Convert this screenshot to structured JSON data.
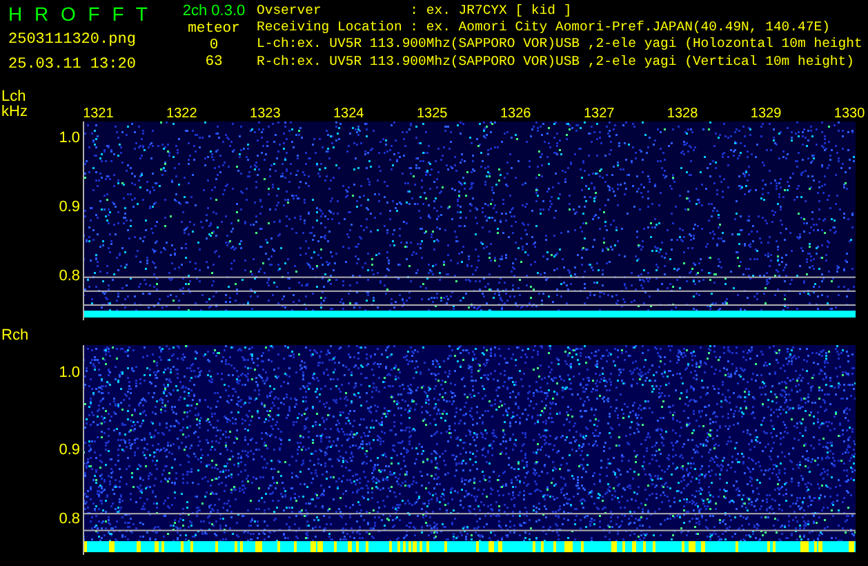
{
  "header": {
    "app_name": "H R O F F T",
    "version": "2ch 0.3.0",
    "filename": "2503111320.png",
    "datetime": "25.03.11 13:20",
    "count_label": "meteor",
    "counts": [
      "0",
      "63"
    ],
    "info_lines": [
      "Ovserver           : ex. JR7CYX [ kid ]",
      "Receiving Location : ex. Aomori City Aomori-Pref.JAPAN(40.49N, 140.47E)",
      "L-ch:ex. UV5R 113.900Mhz(SAPPORO VOR)USB ,2-ele yagi (Holozontal 10m height",
      "R-ch:ex. UV5R 113.900Mhz(SAPPORO VOR)USB ,2-ele yagi (Vertical 10m height)"
    ]
  },
  "time_ticks": [
    "1321",
    "1322",
    "1323",
    "1324",
    "1325",
    "1326",
    "1327",
    "1328",
    "1329",
    "1330"
  ],
  "panels": [
    {
      "channel": "Lch",
      "unit": "kHz",
      "freq_ticks": [
        "1.0",
        "0.9",
        "0.8"
      ]
    },
    {
      "channel": "Rch",
      "freq_ticks": [
        "1.0",
        "0.9",
        "0.8"
      ]
    }
  ]
}
